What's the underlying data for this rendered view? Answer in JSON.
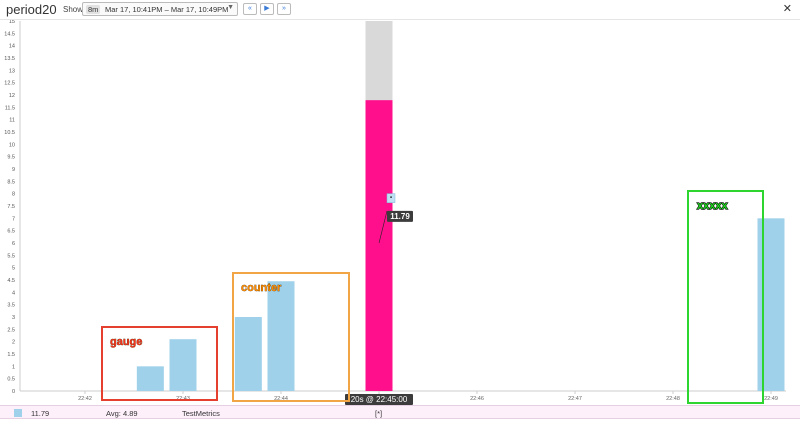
{
  "window": {
    "title": "period20"
  },
  "toolbar": {
    "show_label": "Show",
    "duration": "8m",
    "range_text": "Mar 17, 10:41PM – Mar 17, 10:49PM",
    "caret_icon": "dropdown-caret-icon",
    "nav": [
      {
        "icon": "rewind-icon",
        "glyph": "«"
      },
      {
        "icon": "play-icon",
        "glyph": "▶"
      },
      {
        "icon": "fast-forward-icon",
        "glyph": "»"
      }
    ],
    "close_glyph": "✕"
  },
  "chart_data": {
    "type": "bar",
    "x_ticks": [
      "22:42",
      "22:43",
      "22:44",
      "22:45",
      "22:46",
      "22:47",
      "22:48",
      "22:49"
    ],
    "y_ticks": [
      "0",
      "0.5",
      "1",
      "1.5",
      "2",
      "2.5",
      "3",
      "3.5",
      "4",
      "4.5",
      "5",
      "5.5",
      "6",
      "6.5",
      "7",
      "7.5",
      "8",
      "8.5",
      "9",
      "9.5",
      "10",
      "10.5",
      "11",
      "11.5",
      "12",
      "12.5",
      "13",
      "13.5",
      "14",
      "14.5",
      "15"
    ],
    "ylim": [
      0,
      15
    ],
    "series": [
      {
        "name": "TestMetrics",
        "color": "#9fd1ea",
        "values": [
          {
            "x": "22:42:40",
            "y": 1.0
          },
          {
            "x": "22:43:00",
            "y": 2.1
          },
          {
            "x": "22:43:40",
            "y": 3.0
          },
          {
            "x": "22:44:00",
            "y": 4.45
          },
          {
            "x": "22:45:00",
            "y": 11.79,
            "highlighted": true,
            "color": "#ff0f8c"
          },
          {
            "x": "22:49:00",
            "y": 7.0
          }
        ]
      }
    ],
    "hover": {
      "time_label": "20s @ 22:45:00",
      "value_label": "11.79",
      "marker_glyph": "•",
      "column_color": "#d9d9d9"
    },
    "annotations": [
      {
        "text": "gauge",
        "color": "#f5321b",
        "box_color": "#e53f2f"
      },
      {
        "text": "counter",
        "color": "#ff8a00",
        "box_color": "#f1a544"
      },
      {
        "text": "xxxxx",
        "color": "#22dd22",
        "box_color": "#2ed52e"
      }
    ]
  },
  "legend": {
    "value": "11.79",
    "avg": "Avg: 4.89",
    "source": "TestMetrics",
    "tag": "[*]",
    "swatch_color": "#9fd1ea"
  }
}
